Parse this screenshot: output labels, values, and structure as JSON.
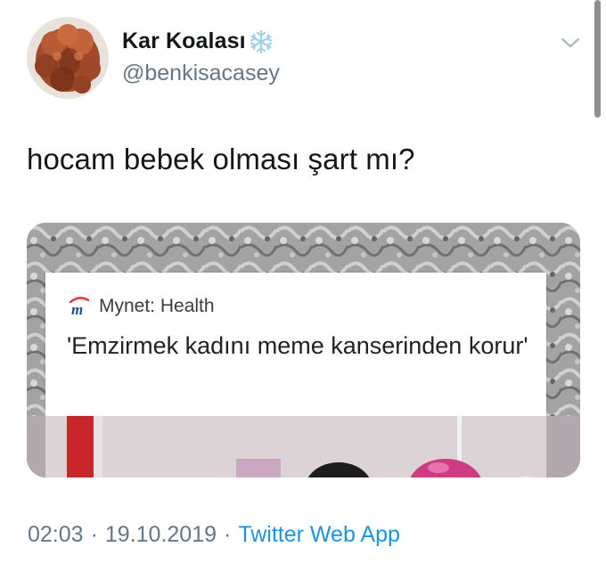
{
  "user": {
    "display_name": "Kar Koalası",
    "handle": "@benkisacasey"
  },
  "icons": {
    "name_emoji": "snowflake-icon",
    "menu": "chevron-down-icon",
    "news_logo": "mynet-logo-icon"
  },
  "tweet": {
    "text": "hocam bebek olması şart mı?"
  },
  "media": {
    "source": "Mynet: Health",
    "headline": "'Emzirmek kadını meme kanserinden korur'"
  },
  "meta": {
    "time": "02:03",
    "date": "19.10.2019",
    "separator": "·",
    "app": "Twitter Web App"
  },
  "colors": {
    "text": "#14171a",
    "secondary": "#657786",
    "link": "#1b95e0"
  }
}
